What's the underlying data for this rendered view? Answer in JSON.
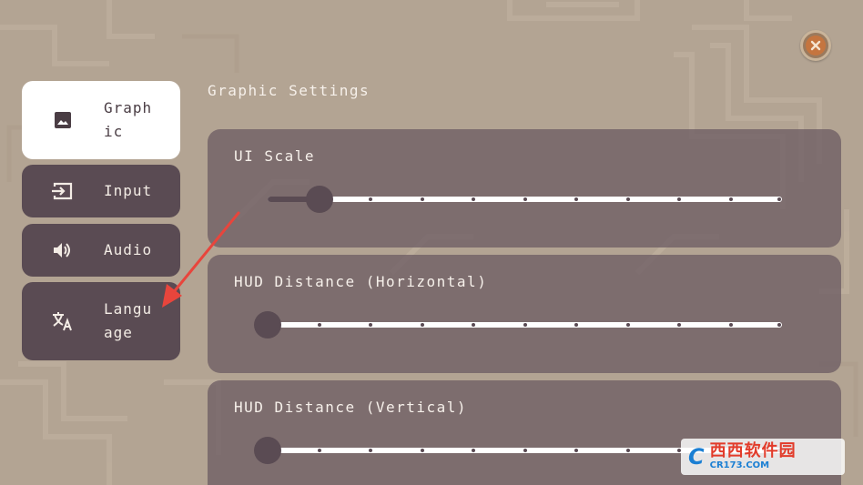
{
  "tabs": [
    {
      "label": "Graphic",
      "icon": "image-icon",
      "active": true
    },
    {
      "label": "Input",
      "icon": "input-icon",
      "active": false
    },
    {
      "label": "Audio",
      "icon": "speaker-icon",
      "active": false
    },
    {
      "label": "Language",
      "icon": "translate-icon",
      "active": false
    }
  ],
  "section_title": "Graphic Settings",
  "settings": [
    {
      "label": "UI Scale",
      "value_fraction": 0.1,
      "steps": 10
    },
    {
      "label": "HUD Distance (Horizontal)",
      "value_fraction": 0.0,
      "steps": 10
    },
    {
      "label": "HUD Distance (Vertical)",
      "value_fraction": 0.0,
      "steps": 10
    }
  ],
  "close_button": {
    "icon": "close-icon"
  },
  "annotation": {
    "icon": "red-arrow-icon",
    "color": "#e8453c"
  },
  "watermark": {
    "logo": "C",
    "text": "西西软件园",
    "url": "CR173.COM"
  },
  "colors": {
    "background": "#b3a493",
    "tab_bg": "#5a4b53",
    "tab_active_bg": "#ffffff",
    "panel_bg": "#6e5e64",
    "text": "#f3ece5"
  }
}
